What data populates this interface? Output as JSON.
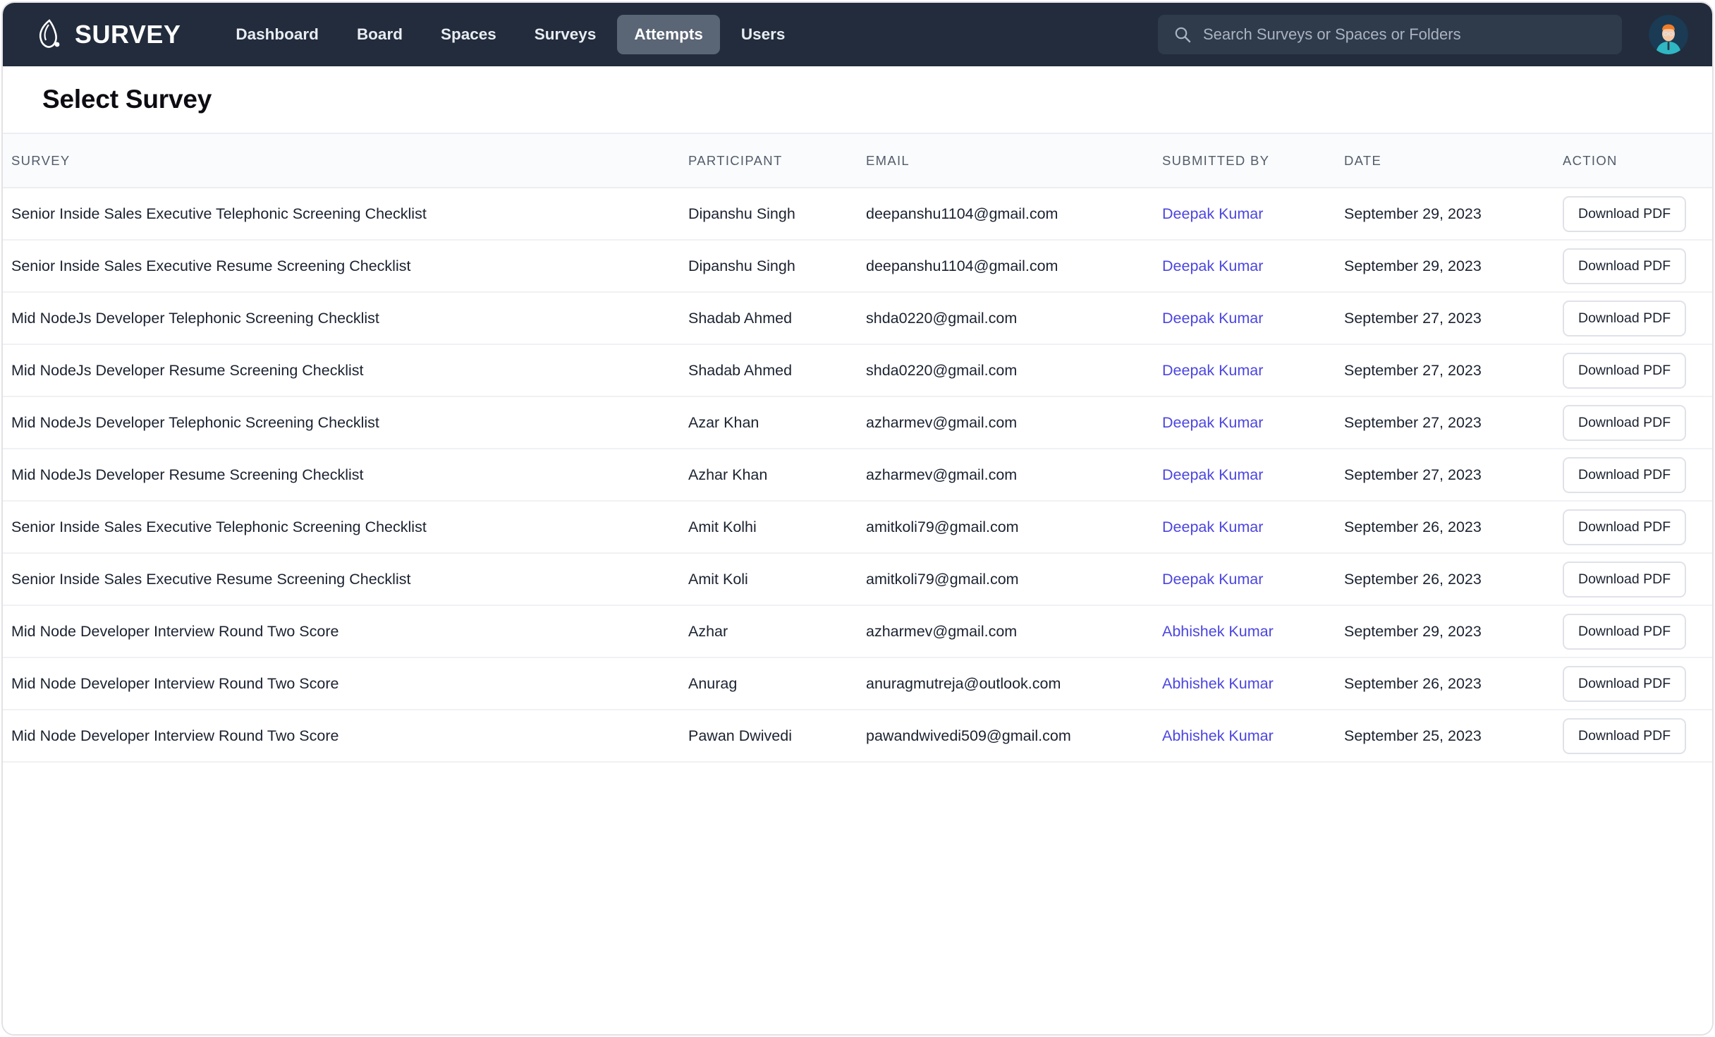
{
  "navbar": {
    "brand": "SURVEY",
    "logo_icon": "survey-leaf-logo-icon",
    "links": [
      {
        "label": "Dashboard",
        "active": false
      },
      {
        "label": "Board",
        "active": false
      },
      {
        "label": "Spaces",
        "active": false
      },
      {
        "label": "Surveys",
        "active": false
      },
      {
        "label": "Attempts",
        "active": true
      },
      {
        "label": "Users",
        "active": false
      }
    ],
    "search": {
      "icon": "search-icon",
      "placeholder": "Search Surveys or Spaces or Folders",
      "value": ""
    },
    "avatar_icon": "user-avatar",
    "colors": {
      "bar_background": "#222c3c",
      "active_tab_background": "#5a6575",
      "search_background": "#2f3a4b"
    }
  },
  "page": {
    "title": "Select Survey"
  },
  "table": {
    "columns": [
      "SURVEY",
      "PARTICIPANT",
      "EMAIL",
      "SUBMITTED BY",
      "DATE",
      "ACTION"
    ],
    "action_label": "Download PDF",
    "link_color": "#4b45e0",
    "rows": [
      {
        "survey": "Senior Inside Sales Executive Telephonic Screening Checklist",
        "participant": "Dipanshu Singh",
        "email": "deepanshu1104@gmail.com",
        "submitted_by": "Deepak Kumar",
        "date": "September 29, 2023",
        "action": "Download PDF"
      },
      {
        "survey": "Senior Inside Sales Executive Resume Screening Checklist",
        "participant": "Dipanshu Singh",
        "email": "deepanshu1104@gmail.com",
        "submitted_by": "Deepak Kumar",
        "date": "September 29, 2023",
        "action": "Download PDF"
      },
      {
        "survey": "Mid NodeJs Developer Telephonic Screening Checklist",
        "participant": "Shadab Ahmed",
        "email": "shda0220@gmail.com",
        "submitted_by": "Deepak Kumar",
        "date": "September 27, 2023",
        "action": "Download PDF"
      },
      {
        "survey": "Mid NodeJs Developer Resume Screening Checklist",
        "participant": "Shadab Ahmed",
        "email": "shda0220@gmail.com",
        "submitted_by": "Deepak Kumar",
        "date": "September 27, 2023",
        "action": "Download PDF"
      },
      {
        "survey": "Mid NodeJs Developer Telephonic Screening Checklist",
        "participant": "Azar Khan",
        "email": "azharmev@gmail.com",
        "submitted_by": "Deepak Kumar",
        "date": "September 27, 2023",
        "action": "Download PDF"
      },
      {
        "survey": "Mid NodeJs Developer Resume Screening Checklist",
        "participant": "Azhar Khan",
        "email": "azharmev@gmail.com",
        "submitted_by": "Deepak Kumar",
        "date": "September 27, 2023",
        "action": "Download PDF"
      },
      {
        "survey": "Senior Inside Sales Executive Telephonic Screening Checklist",
        "participant": "Amit Kolhi",
        "email": "amitkoli79@gmail.com",
        "submitted_by": "Deepak Kumar",
        "date": "September 26, 2023",
        "action": "Download PDF"
      },
      {
        "survey": "Senior Inside Sales Executive Resume Screening Checklist",
        "participant": "Amit Koli",
        "email": "amitkoli79@gmail.com",
        "submitted_by": "Deepak Kumar",
        "date": "September 26, 2023",
        "action": "Download PDF"
      },
      {
        "survey": "Mid Node Developer Interview Round Two Score",
        "participant": "Azhar",
        "email": "azharmev@gmail.com",
        "submitted_by": "Abhishek Kumar",
        "date": "September 29, 2023",
        "action": "Download PDF"
      },
      {
        "survey": "Mid Node Developer Interview Round Two Score",
        "participant": "Anurag",
        "email": "anuragmutreja@outlook.com",
        "submitted_by": "Abhishek Kumar",
        "date": "September 26, 2023",
        "action": "Download PDF"
      },
      {
        "survey": "Mid Node Developer Interview Round Two Score",
        "participant": "Pawan Dwivedi",
        "email": "pawandwivedi509@gmail.com",
        "submitted_by": "Abhishek Kumar",
        "date": "September 25, 2023",
        "action": "Download PDF"
      }
    ]
  }
}
